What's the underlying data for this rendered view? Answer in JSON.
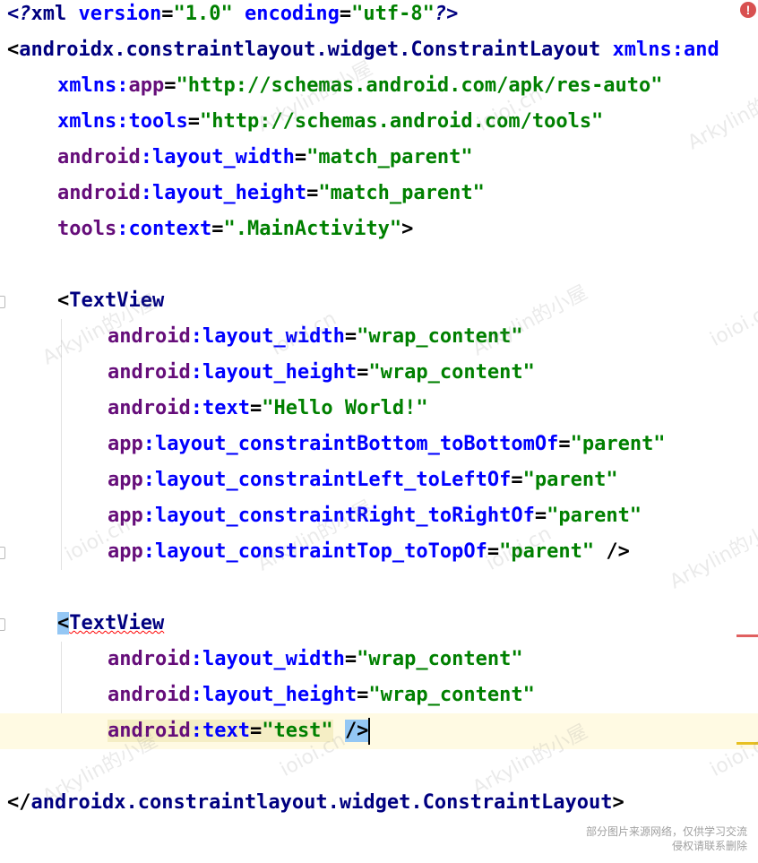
{
  "code": {
    "xml_decl_open": "<?",
    "xml_decl_name": "xml",
    "xml_decl_attr1": "version",
    "xml_decl_val1": "\"1.0\"",
    "xml_decl_attr2": "encoding",
    "xml_decl_val2": "\"utf-8\"",
    "xml_decl_close": "?>",
    "root_tag": "androidx.constraintlayout.widget.ConstraintLayout",
    "xmlns_android_partial": "xmlns:and",
    "xmlns_app_prefix": "xmlns:",
    "xmlns_app_name": "app",
    "xmlns_app_val": "\"http://schemas.android.com/apk/res-auto\"",
    "xmlns_tools_prefix": "xmlns:",
    "xmlns_tools_name": "tools",
    "xmlns_tools_val": "\"http://schemas.android.com/tools\"",
    "ns_android": "android",
    "ns_app": "app",
    "ns_tools": "tools",
    "attr_layout_width": "layout_width",
    "attr_layout_height": "layout_height",
    "attr_context": "context",
    "attr_text": "text",
    "attr_bottom": "layout_constraintBottom_toBottomOf",
    "attr_left": "layout_constraintLeft_toLeftOf",
    "attr_right": "layout_constraintRight_toRightOf",
    "attr_top": "layout_constraintTop_toTopOf",
    "val_match_parent": "\"match_parent\"",
    "val_wrap_content": "\"wrap_content\"",
    "val_main_activity": "\".MainActivity\"",
    "val_hello_world": "\"Hello World!\"",
    "val_parent": "\"parent\"",
    "val_test": "\"test\"",
    "textview_tag": "TextView",
    "self_close": "/>",
    "close_angle": ">",
    "open_angle": "<",
    "close_tag_open": "</"
  },
  "status": {
    "error_icon": "error-icon",
    "error_glyph": "!"
  },
  "watermarks": {
    "text_a": "Arkylin的小屋",
    "text_b": "ioioi.cn"
  },
  "footer": {
    "line1": "部分图片来源网络，仅供学习交流",
    "line2": "侵权请联系删除"
  },
  "colors": {
    "tag": "#000080",
    "attr": "#0000ff",
    "namespace": "#660e7a",
    "value": "#008000",
    "current_line": "#fffae3",
    "tag_highlight": "#94c7f4",
    "error": "#d85050"
  }
}
